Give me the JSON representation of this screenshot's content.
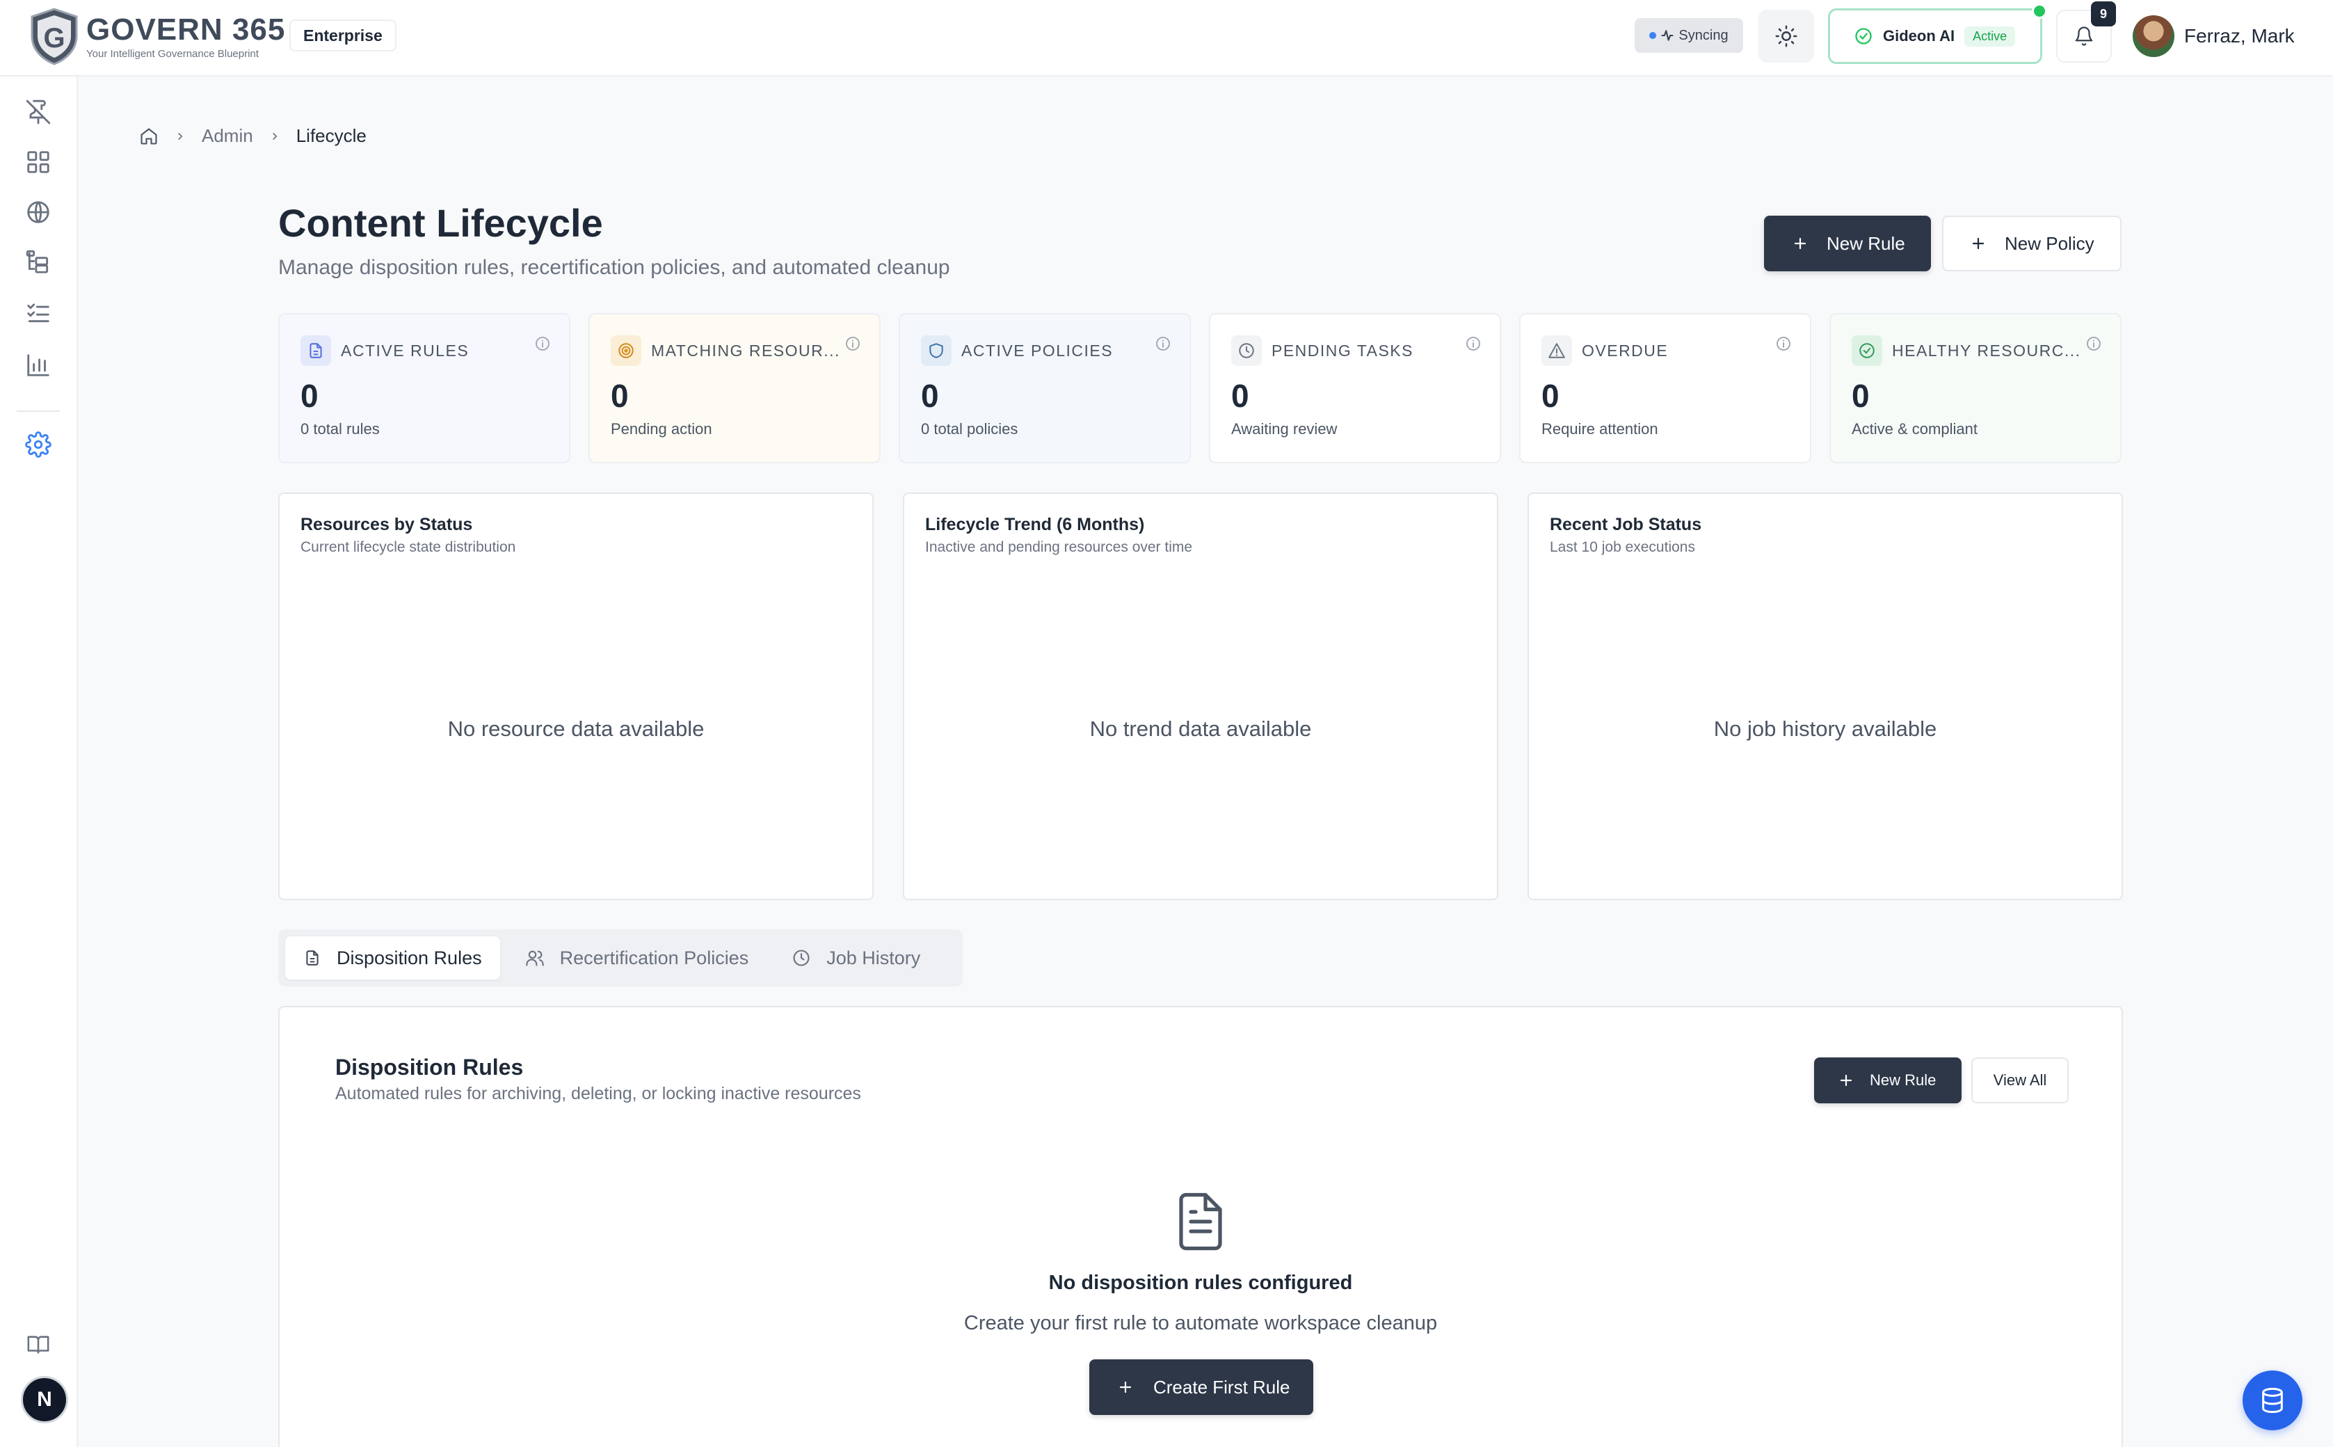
{
  "header": {
    "logo_name": "GOVERN 365",
    "logo_tagline": "Your Intelligent Governance Blueprint",
    "edition": "Enterprise",
    "sync_status": "Syncing",
    "ai_name": "Gideon AI",
    "ai_status": "Active",
    "notification_count": "9",
    "user_name": "Ferraz, Mark"
  },
  "sidebar": {
    "icons": [
      "pin-off-icon",
      "grid-icon",
      "globe-icon",
      "hierarchy-icon",
      "list-check-icon",
      "bar-chart-icon",
      "gear-icon",
      "book-icon"
    ],
    "avatar_letter": "N"
  },
  "breadcrumb": [
    "Admin",
    "Lifecycle"
  ],
  "page": {
    "title": "Content Lifecycle",
    "subtitle": "Manage disposition rules, recertification policies, and automated cleanup",
    "new_rule_label": "New Rule",
    "new_policy_label": "New Policy"
  },
  "stats": [
    {
      "label": "ACTIVE RULES",
      "value": "0",
      "note": "0 total rules",
      "bg": "#f6f8fd",
      "icon_bg": "#e3e9fb",
      "icon_color": "#4f6bd8"
    },
    {
      "label": "MATCHING RESOUR...",
      "value": "0",
      "note": "Pending action",
      "bg": "#fdfbf3",
      "icon_bg": "#fbeed7",
      "icon_color": "#d48a1a"
    },
    {
      "label": "ACTIVE POLICIES",
      "value": "0",
      "note": "0 total policies",
      "bg": "#f4f8fc",
      "icon_bg": "#e2ecf7",
      "icon_color": "#3a6ea5"
    },
    {
      "label": "PENDING TASKS",
      "value": "0",
      "note": "Awaiting review",
      "bg": "#ffffff",
      "icon_bg": "#f1f3f5",
      "icon_color": "#6b7280"
    },
    {
      "label": "OVERDUE",
      "value": "0",
      "note": "Require attention",
      "bg": "#ffffff",
      "icon_bg": "#f1f3f5",
      "icon_color": "#6b7280"
    },
    {
      "label": "HEALTHY RESOURC...",
      "value": "0",
      "note": "Active & compliant",
      "bg": "#f6fbf7",
      "icon_bg": "#ddf2e4",
      "icon_color": "#2f9a5a"
    }
  ],
  "charts": [
    {
      "title": "Resources by Status",
      "subtitle": "Current lifecycle state distribution",
      "empty": "No resource data available"
    },
    {
      "title": "Lifecycle Trend (6 Months)",
      "subtitle": "Inactive and pending resources over time",
      "empty": "No trend data available"
    },
    {
      "title": "Recent Job Status",
      "subtitle": "Last 10 job executions",
      "empty": "No job history available"
    }
  ],
  "tabs": [
    {
      "label": "Disposition Rules",
      "icon": "document-icon",
      "active": true
    },
    {
      "label": "Recertification Policies",
      "icon": "users-icon",
      "active": false
    },
    {
      "label": "Job History",
      "icon": "clock-icon",
      "active": false
    }
  ],
  "rules_panel": {
    "title": "Disposition Rules",
    "subtitle": "Automated rules for archiving, deleting, or locking inactive resources",
    "new_rule_label": "New Rule",
    "view_all_label": "View All",
    "empty_title": "No disposition rules configured",
    "empty_subtitle": "Create your first rule to automate workspace cleanup",
    "create_label": "Create First Rule"
  },
  "colors": {
    "primary_dark": "#2d3748",
    "accent_green": "#22c55e",
    "fab_blue": "#2563eb"
  }
}
